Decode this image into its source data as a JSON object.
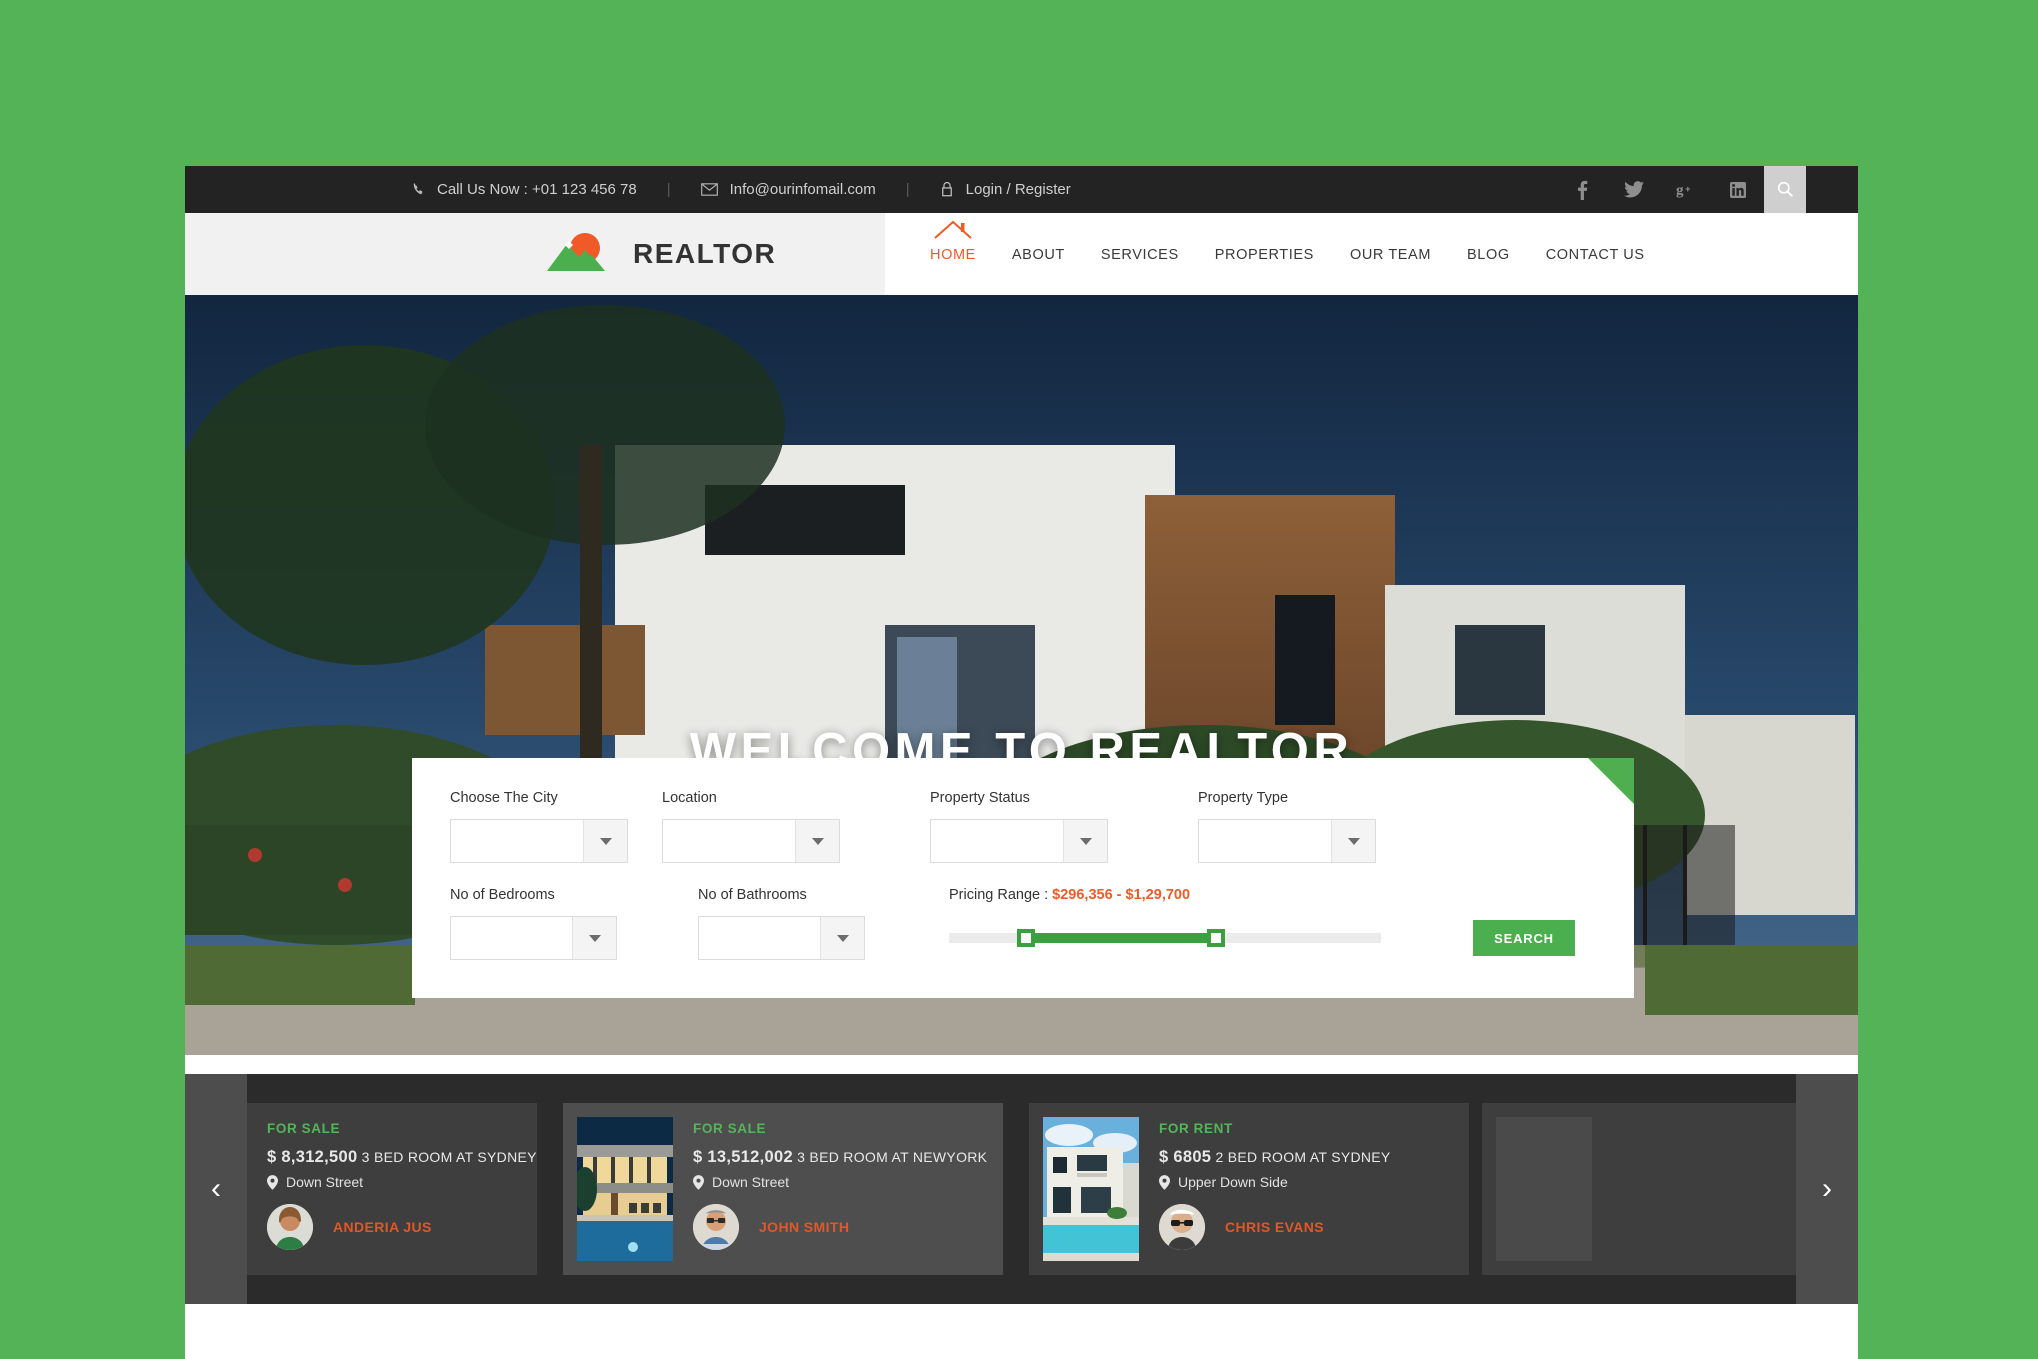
{
  "topbar": {
    "phone": "Call Us Now : +01 123 456 78",
    "email": "Info@ourinfomail.com",
    "account": "Login / Register",
    "separator": "|",
    "social": [
      {
        "name": "facebook-icon",
        "label": "f"
      },
      {
        "name": "twitter-icon",
        "label": "t"
      },
      {
        "name": "google-plus-icon",
        "label": "g+"
      },
      {
        "name": "linkedin-icon",
        "label": "in"
      }
    ],
    "search_icon": "search-icon"
  },
  "brand": {
    "name": "REALTOR",
    "sun_color": "#f05a28",
    "hill_color": "#4caf4f"
  },
  "nav": {
    "items": [
      {
        "label": "HOME",
        "active": true
      },
      {
        "label": "ABOUT",
        "active": false
      },
      {
        "label": "SERVICES",
        "active": false
      },
      {
        "label": "PROPERTIES",
        "active": false
      },
      {
        "label": "OUR TEAM",
        "active": false
      },
      {
        "label": "BLOG",
        "active": false
      },
      {
        "label": "CONTACT US",
        "active": false
      }
    ],
    "active_color": "#ef5b25"
  },
  "hero": {
    "title": "WELCOME TO REALTOR"
  },
  "search_panel": {
    "fields": [
      {
        "label": "Choose The City",
        "value": ""
      },
      {
        "label": "Location",
        "value": ""
      },
      {
        "label": "Property Status",
        "value": ""
      },
      {
        "label": "Property Type",
        "value": ""
      },
      {
        "label": "No of Bedrooms",
        "value": ""
      },
      {
        "label": "No of Bathrooms",
        "value": ""
      }
    ],
    "pricing_label": "Pricing Range : ",
    "pricing_value": "$296,356 - $1,29,700",
    "pricing_color": "#ef5b25",
    "slider": {
      "min_percent": 17,
      "max_percent": 63,
      "track_color": "#3ba140"
    },
    "search_button": "SEARCH",
    "button_color": "#4caf4f",
    "corner_color": "#4faf4f"
  },
  "carousel": {
    "prev_icon": "chevron-left-icon",
    "next_icon": "chevron-right-icon",
    "prev_label": "‹",
    "next_label": "›",
    "location_icon": "map-pin-icon",
    "cards": [
      {
        "tag": "FOR SALE",
        "price": "$ 8,312,500",
        "detail": "3 BED ROOM AT SYDNEY",
        "location": "Down Street",
        "agent": "ANDERIA JUS"
      },
      {
        "tag": "FOR SALE",
        "price": "$ 13,512,002",
        "detail": "3 BED ROOM AT NEWYORK",
        "location": "Down Street",
        "agent": "JOHN SMITH"
      },
      {
        "tag": "FOR RENT",
        "price": "$ 6805",
        "detail": "2 BED ROOM AT SYDNEY",
        "location": "Upper Down Side",
        "agent": "CHRIS EVANS"
      }
    ],
    "tag_color": "#55b45a",
    "agent_color": "#e0572a"
  }
}
